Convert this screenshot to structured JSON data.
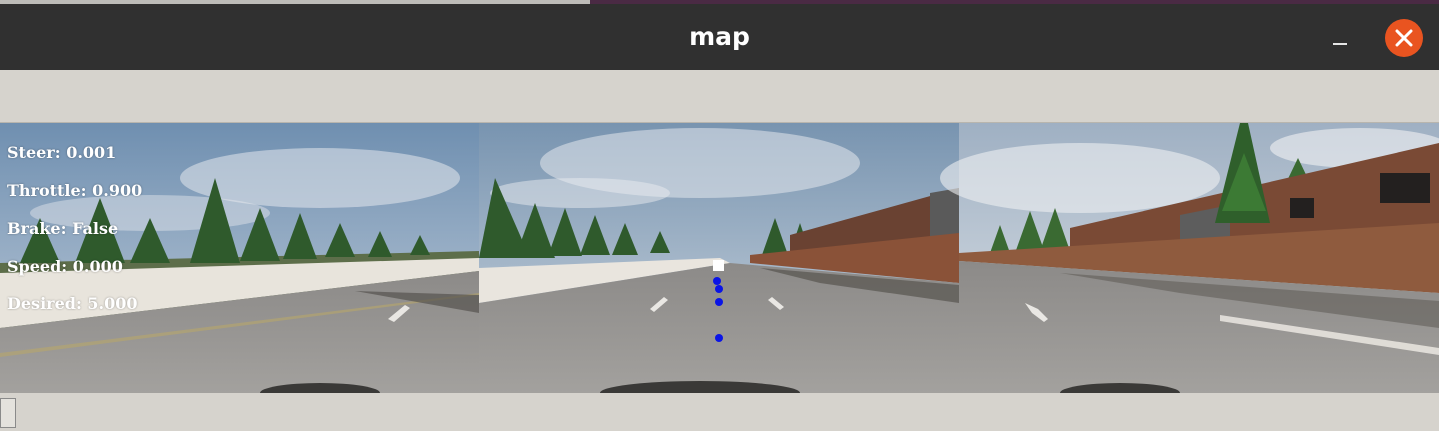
{
  "window": {
    "title": "map"
  },
  "hud": {
    "lines": [
      "Steer: 0.001",
      "Throttle: 0.900",
      "Brake: False",
      "Speed: 0.000",
      "Desired: 5.000"
    ]
  },
  "icons": {
    "minimize": "minimize-icon",
    "close": "close-icon"
  },
  "colors": {
    "titlebar": "#303030",
    "close_button": "#e95420",
    "window_frame": "#d6d3cd",
    "waypoint_dot": "#0a14e6",
    "target_marker": "#ffffff"
  }
}
